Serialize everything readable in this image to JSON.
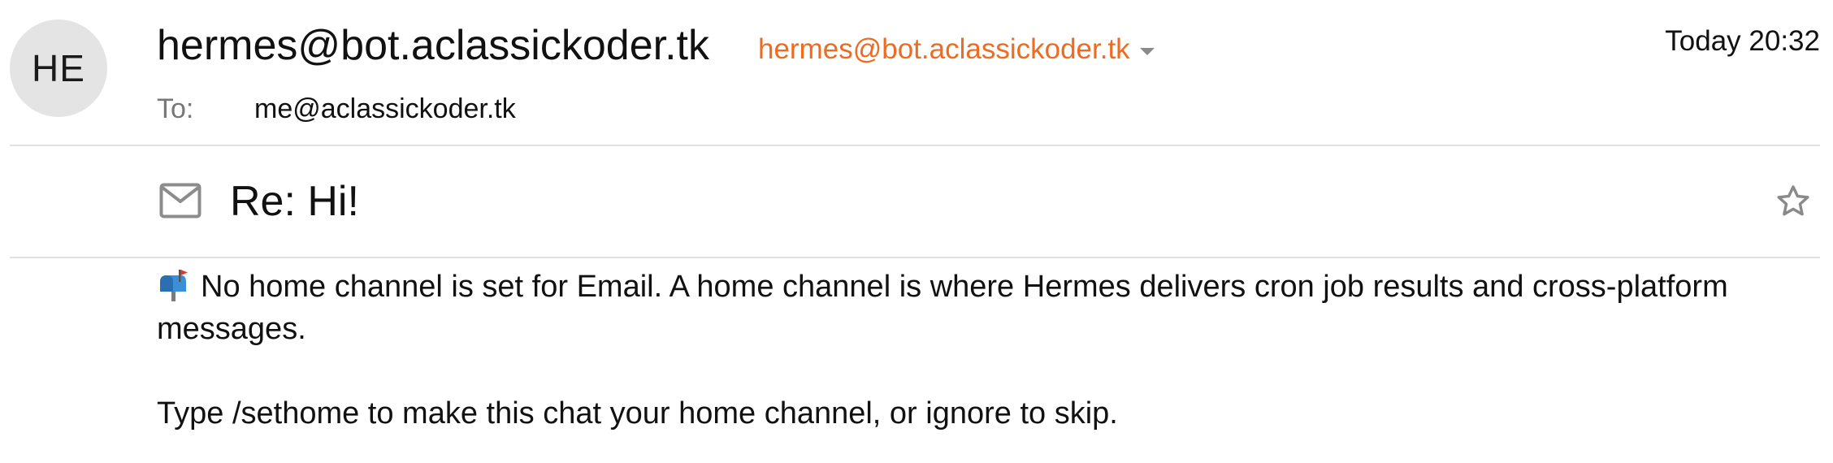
{
  "sender": {
    "initials": "HE",
    "name": "hermes@bot.aclassickoder.tk",
    "address": "hermes@bot.aclassickoder.tk"
  },
  "date": "Today 20:32",
  "recipient": {
    "label": "To:",
    "address": "me@aclassickoder.tk"
  },
  "subject": "Re: Hi!",
  "icons": {
    "mail": "envelope-icon",
    "star": "star-icon",
    "mailbox": "mailbox-icon",
    "caret": "chevron-down-icon"
  },
  "colors": {
    "accent": "#ee6b21",
    "avatar_bg": "#e4e4e4",
    "divider": "#e2e2e2"
  },
  "body": {
    "paragraph1": "No home channel is set for Email. A home channel is where Hermes delivers cron job results and cross-platform messages.",
    "paragraph2": "Type /sethome to make this chat your home channel, or ignore to skip."
  }
}
